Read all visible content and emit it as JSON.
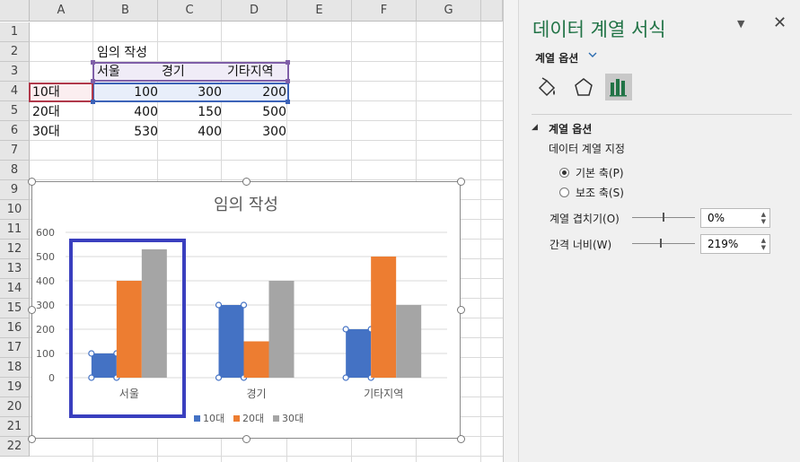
{
  "sheet": {
    "columns": [
      "A",
      "B",
      "C",
      "D",
      "E",
      "F",
      "G"
    ],
    "rows": [
      "1",
      "2",
      "3",
      "4",
      "5",
      "6",
      "7",
      "8",
      "9",
      "10",
      "11",
      "12",
      "13",
      "14",
      "15",
      "16",
      "17",
      "18",
      "19",
      "20",
      "21",
      "22"
    ],
    "title_cell": "임의 작성",
    "headers": [
      "서울",
      "경기",
      "기타지역"
    ],
    "table": [
      {
        "label": "10대",
        "values": [
          "100",
          "300",
          "200"
        ]
      },
      {
        "label": "20대",
        "values": [
          "400",
          "150",
          "500"
        ]
      },
      {
        "label": "30대",
        "values": [
          "530",
          "400",
          "300"
        ]
      }
    ]
  },
  "chart_data": {
    "type": "bar",
    "title": "임의 작성",
    "categories": [
      "서울",
      "경기",
      "기타지역"
    ],
    "series": [
      {
        "name": "10대",
        "values": [
          100,
          300,
          200
        ],
        "color": "#4472c4"
      },
      {
        "name": "20대",
        "values": [
          400,
          150,
          500
        ],
        "color": "#ed7d31"
      },
      {
        "name": "30대",
        "values": [
          530,
          400,
          300
        ],
        "color": "#a5a5a5"
      }
    ],
    "ylim": [
      0,
      600
    ],
    "yticks": [
      "0",
      "100",
      "200",
      "300",
      "400",
      "500",
      "600"
    ],
    "grid": true,
    "legend": "bottom",
    "highlight_box_color": "#3a3fbf"
  },
  "pane": {
    "title": "데이터 계열 서식",
    "dropdown_label": "계열 옵션",
    "icons": [
      "fill-line-icon",
      "effects-icon",
      "series-options-icon"
    ],
    "section_title": "계열 옵션",
    "plot_on_label": "데이터 계열 지정",
    "radio_primary": "기본 축(P)",
    "radio_secondary": "보조 축(S)",
    "overlap_label": "계열 겹치기(O)",
    "overlap_value": "0%",
    "gap_label": "간격 너비(W)",
    "gap_value": "219%",
    "accent": "#217346"
  }
}
